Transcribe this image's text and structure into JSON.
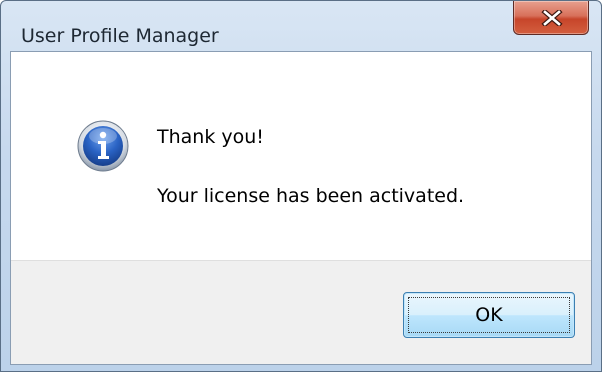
{
  "window": {
    "title": "User Profile Manager",
    "close_glyph": "X"
  },
  "message": {
    "icon": "info-icon",
    "heading": "Thank you!",
    "body": "Your license has been activated."
  },
  "buttons": {
    "ok_label": "OK"
  },
  "colors": {
    "titlebar": "#c7d9ee",
    "close_button": "#c7452a",
    "ok_button_border": "#3c7fb1",
    "info_icon": "#2a63c4",
    "button_area": "#f0f0f0"
  }
}
